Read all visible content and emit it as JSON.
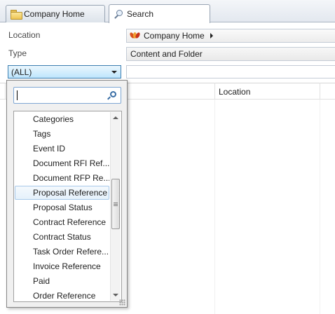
{
  "tabs": [
    {
      "label": "Company Home",
      "icon": "folder-icon",
      "active": false
    },
    {
      "label": "Search",
      "icon": "search-icon",
      "active": true
    }
  ],
  "form": {
    "location_label": "Location",
    "location_value": "Company Home",
    "type_label": "Type",
    "type_value": "Content and Folder",
    "field_selector_value": "(ALL)",
    "filter_value": ""
  },
  "grid": {
    "columns": [
      "",
      "Location",
      ""
    ]
  },
  "dropdown": {
    "search_value": "",
    "items": [
      "Categories",
      "Tags",
      "Event ID",
      "Document RFI Ref...",
      "Document RFP Re...",
      "Proposal Reference",
      "Proposal Status",
      "Contract Reference",
      "Contract Status",
      "Task Order Refere...",
      "Invoice Reference",
      "Paid",
      "Order Reference"
    ],
    "hovered_index": 5
  },
  "colors": {
    "combo_border": "#3c7fb1",
    "hover_border": "#a8c9ea",
    "accent_icon": "#d9531e"
  }
}
